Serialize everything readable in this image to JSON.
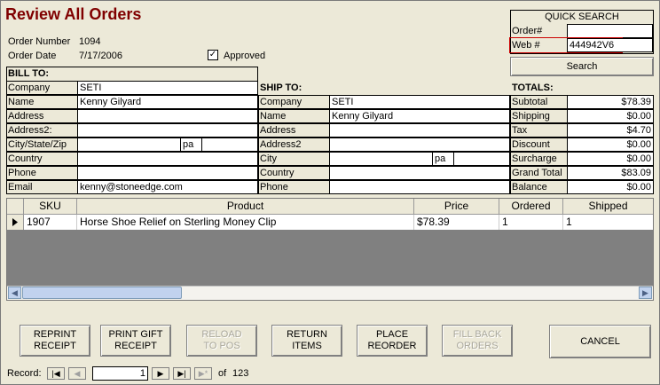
{
  "title": "Review All Orders",
  "order": {
    "number_label": "Order Number",
    "number": "1094",
    "date_label": "Order Date",
    "date": "7/17/2006",
    "approved_label": "Approved",
    "approved_mark": "✓"
  },
  "quick_search": {
    "title": "QUICK SEARCH",
    "order_label": "Order#",
    "order_value": "",
    "web_label": "Web #",
    "web_value": "444942V6",
    "search_label": "Search"
  },
  "bill_to": {
    "title": "BILL TO:",
    "company_label": "Company",
    "company": "SETI",
    "name_label": "Name",
    "name": "Kenny Gilyard",
    "address_label": "Address",
    "address": "",
    "address2_label": "Address2:",
    "address2": "",
    "csz_label": "City/State/Zip",
    "city": "",
    "state": "pa",
    "zip": "",
    "country_label": "Country",
    "country": "",
    "phone_label": "Phone",
    "phone": "",
    "email_label": "Email",
    "email": "kenny@stoneedge.com"
  },
  "ship_to": {
    "title": "SHIP TO:",
    "company_label": "Company",
    "company": "SETI",
    "name_label": "Name",
    "name": "Kenny Gilyard",
    "address_label": "Address",
    "address": "",
    "address2_label": "Address2",
    "address2": "",
    "city_label": "City",
    "city": "",
    "state": "pa",
    "zip": "",
    "country_label": "Country",
    "country": "",
    "phone_label": "Phone",
    "phone": ""
  },
  "totals": {
    "title": "TOTALS:",
    "subtotal_label": "Subtotal",
    "subtotal": "$78.39",
    "shipping_label": "Shipping",
    "shipping": "$0.00",
    "tax_label": "Tax",
    "tax": "$4.70",
    "discount_label": "Discount",
    "discount": "$0.00",
    "surcharge_label": "Surcharge",
    "surcharge": "$0.00",
    "grand_total_label": "Grand Total",
    "grand_total": "$83.09",
    "balance_label": "Balance",
    "balance": "$0.00"
  },
  "items": {
    "headers": {
      "sku": "SKU",
      "product": "Product",
      "price": "Price",
      "ordered": "Ordered",
      "shipped": "Shipped"
    },
    "rows": [
      {
        "sku": "1907",
        "product": "Horse  Shoe Relief on Sterling Money Clip",
        "price": "$78.39",
        "ordered": "1",
        "shipped": "1"
      }
    ]
  },
  "buttons": {
    "reprint_receipt": "REPRINT\nRECEIPT",
    "print_gift_receipt": "PRINT GIFT\nRECEIPT",
    "reload_to_pos": "RELOAD\nTO POS",
    "return_items": "RETURN\nITEMS",
    "place_reorder": "PLACE\nREORDER",
    "fill_back_orders": "FILL BACK\nORDERS",
    "cancel": "CANCEL"
  },
  "record_nav": {
    "label": "Record:",
    "current": "1",
    "of_label": "of",
    "total": "123"
  },
  "colors": {
    "title": "#800000",
    "highlight": "#cc0000",
    "grid_empty": "#808080"
  }
}
